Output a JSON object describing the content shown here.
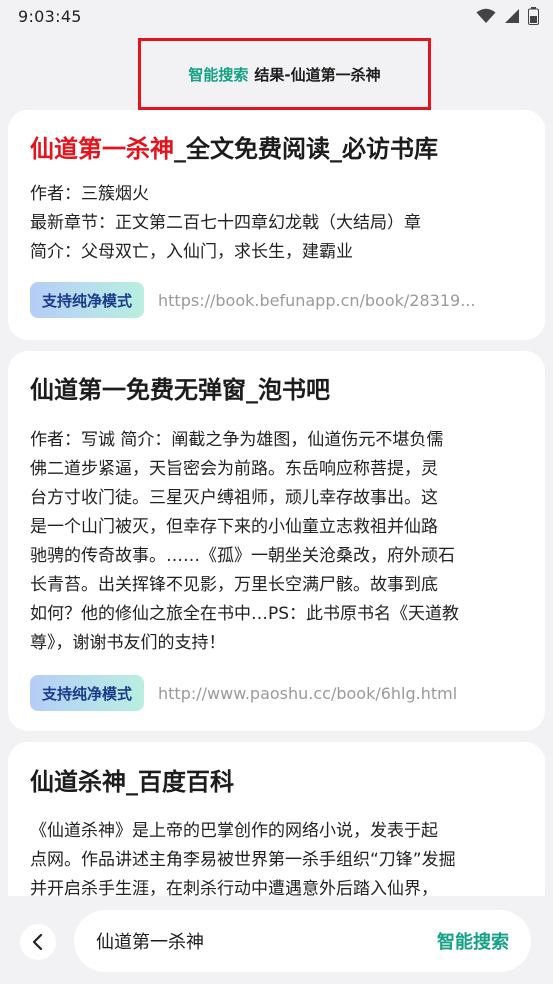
{
  "status_bar": {
    "time": "9:03:45"
  },
  "header": {
    "accent": "智能搜索",
    "rest": "结果-仙道第一杀神"
  },
  "results": [
    {
      "title_highlight": "仙道第一杀神",
      "title_rest": "_全文免费阅读_必访书库",
      "lines": [
        "作者：三簇烟火",
        "最新章节：正文第二百七十四章幻龙戟（大结局）章",
        "简介：父母双亡，入仙门，求长生，建霸业"
      ],
      "badge": "支持纯净模式",
      "url": "https://book.befunapp.cn/book/28319..."
    },
    {
      "title": "仙道第一免费无弹窗_泡书吧",
      "lines": [
        "作者：写诚 简介：阐截之争为雄图，仙道伤元不堪负儒",
        "佛二道步紧逼，天旨密会为前路。东岳响应称菩提，灵",
        "台方寸收门徒。三星灭户缚祖师，顽儿幸存故事出。这",
        "是一个山门被灭，但幸存下来的小仙童立志救祖并仙路",
        "驰骋的传奇故事。……《孤》一朝坐关沧桑改，府外顽石",
        "长青苔。出关挥锋不见影，万里长空满尸骸。故事到底",
        "如何？他的修仙之旅全在书中…PS：此书原书名《天道教",
        "尊》，谢谢书友们的支持！"
      ],
      "badge": "支持纯净模式",
      "url": "http://www.paoshu.cc/book/6hlg.html"
    },
    {
      "title": "仙道杀神_百度百科",
      "lines": [
        "《仙道杀神》是上帝的巴掌创作的网络小说，发表于起",
        "点网。作品讲述主角李易被世界第一杀手组织“刀锋”发掘",
        "并开启杀手生涯，在刺杀行动中遭遇意外后踏入仙界，"
      ]
    }
  ],
  "bottom_bar": {
    "query": "仙道第一杀神",
    "action": "智能搜索"
  },
  "colors": {
    "accent": "#16a085",
    "highlight": "#e5131c",
    "badge_text": "#1a3b8c"
  }
}
